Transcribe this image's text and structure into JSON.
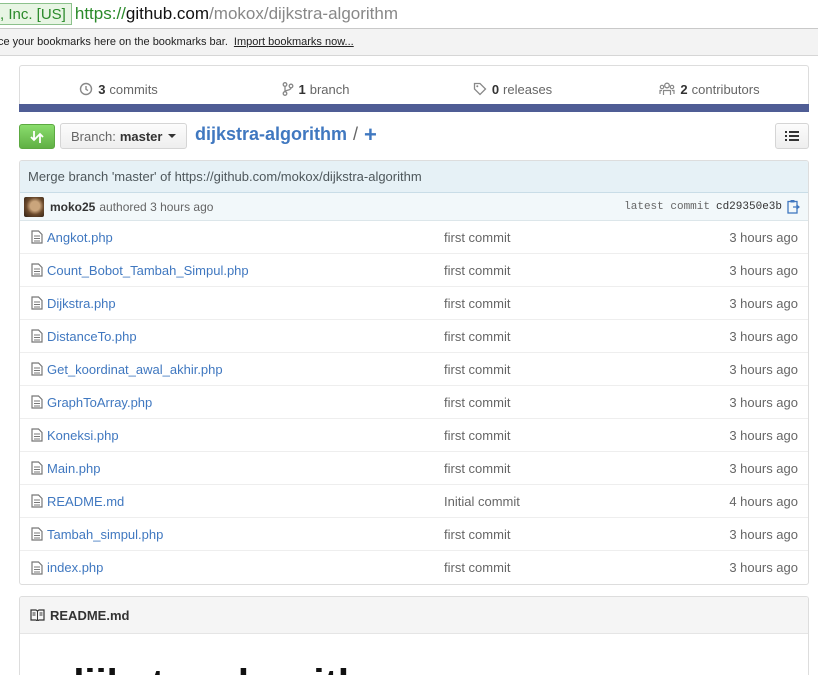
{
  "browser": {
    "ev_cert": ", Inc. [US]",
    "url_scheme": "https://",
    "url_host": "github.com",
    "url_path": "/mokox/dijkstra-algorithm"
  },
  "bookmarks": {
    "hint": "ce your bookmarks here on the bookmarks bar.",
    "import_link": "Import bookmarks now..."
  },
  "summary": {
    "commits": {
      "count": "3",
      "label": "commits"
    },
    "branches": {
      "count": "1",
      "label": "branch"
    },
    "releases": {
      "count": "0",
      "label": "releases"
    },
    "contributors": {
      "count": "2",
      "label": "contributors"
    }
  },
  "colors": {
    "language_bar": "#4f5d95",
    "link": "#4078c0",
    "compare_button": "#60b044"
  },
  "nav": {
    "branch_label": "Branch:",
    "branch_name": "master",
    "repo_name": "dijkstra-algorithm",
    "separator": "/",
    "add_file": "+"
  },
  "commit": {
    "message": "Merge branch 'master' of https://github.com/mokox/dijkstra-algorithm",
    "author": "moko25",
    "authored": "authored 3 hours ago",
    "latest_label": "latest commit",
    "sha": "cd29350e3b"
  },
  "files": [
    {
      "name": "Angkot.php",
      "message": "first commit",
      "age": "3 hours ago"
    },
    {
      "name": "Count_Bobot_Tambah_Simpul.php",
      "message": "first commit",
      "age": "3 hours ago"
    },
    {
      "name": "Dijkstra.php",
      "message": "first commit",
      "age": "3 hours ago"
    },
    {
      "name": "DistanceTo.php",
      "message": "first commit",
      "age": "3 hours ago"
    },
    {
      "name": "Get_koordinat_awal_akhir.php",
      "message": "first commit",
      "age": "3 hours ago"
    },
    {
      "name": "GraphToArray.php",
      "message": "first commit",
      "age": "3 hours ago"
    },
    {
      "name": "Koneksi.php",
      "message": "first commit",
      "age": "3 hours ago"
    },
    {
      "name": "Main.php",
      "message": "first commit",
      "age": "3 hours ago"
    },
    {
      "name": "README.md",
      "message": "Initial commit",
      "age": "4 hours ago"
    },
    {
      "name": "Tambah_simpul.php",
      "message": "first commit",
      "age": "3 hours ago"
    },
    {
      "name": "index.php",
      "message": "first commit",
      "age": "3 hours ago"
    }
  ],
  "readme": {
    "filename": "README.md",
    "heading": "dijkstra-algorithm"
  }
}
